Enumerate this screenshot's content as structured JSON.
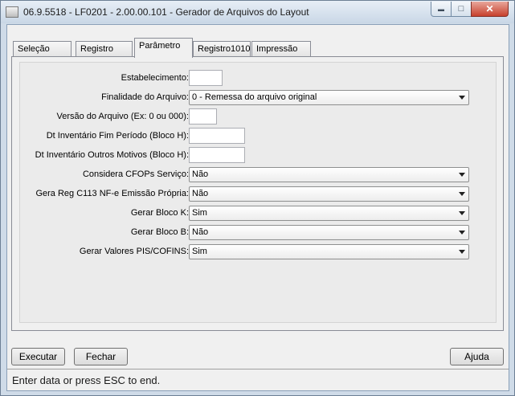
{
  "window": {
    "title": "06.9.5518 - LF0201 - 2.00.00.101 - Gerador de Arquivos do Layout",
    "minimize_glyph": "▬",
    "maximize_glyph": "□",
    "close_glyph": "✕"
  },
  "tabs": [
    {
      "label": "Seleção"
    },
    {
      "label": "Registro"
    },
    {
      "label": "Parâmetro",
      "active": true
    },
    {
      "label": "Registro1010"
    },
    {
      "label": "Impressão"
    }
  ],
  "form": {
    "estabelecimento": {
      "label": "Estabelecimento:",
      "value": ""
    },
    "finalidade": {
      "label": "Finalidade do Arquivo:",
      "value": "0 - Remessa do arquivo original"
    },
    "versao": {
      "label": "Versão do Arquivo (Ex: 0 ou 000):",
      "value": ""
    },
    "dt_inv_fim": {
      "label": "Dt Inventário Fim Período (Bloco H):",
      "value": ""
    },
    "dt_inv_outros": {
      "label": "Dt Inventário Outros Motivos (Bloco H):",
      "value": ""
    },
    "considera_cfops": {
      "label": "Considera CFOPs Serviço:",
      "value": "Não"
    },
    "gera_c113": {
      "label": "Gera Reg C113 NF-e Emissão Própria:",
      "value": "Não"
    },
    "bloco_k": {
      "label": "Gerar Bloco K:",
      "value": "Sim"
    },
    "bloco_b": {
      "label": "Gerar Bloco B:",
      "value": "Não"
    },
    "pis_cofins": {
      "label": "Gerar Valores PIS/COFINS:",
      "value": "Sim"
    }
  },
  "buttons": {
    "executar": "Executar",
    "fechar": "Fechar",
    "ajuda": "Ajuda"
  },
  "status": "Enter data or press ESC to end."
}
